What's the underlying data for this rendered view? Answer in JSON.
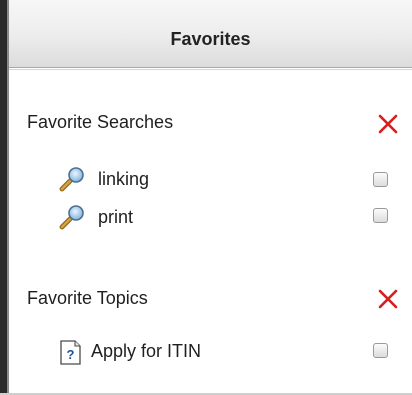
{
  "panel": {
    "title": "Favorites"
  },
  "favorite_searches": {
    "title": "Favorite Searches",
    "remove_icon": "red-x-icon",
    "items": [
      {
        "label": "linking",
        "icon": "magnifier-icon",
        "checked": false
      },
      {
        "label": "print",
        "icon": "magnifier-icon",
        "checked": false
      }
    ]
  },
  "favorite_topics": {
    "title": "Favorite Topics",
    "remove_icon": "red-x-icon",
    "items": [
      {
        "label": "Apply for ITIN",
        "icon": "help-topic-icon",
        "checked": false
      }
    ]
  },
  "colors": {
    "remove": "#d81f1f",
    "text": "#1f1f1f"
  }
}
